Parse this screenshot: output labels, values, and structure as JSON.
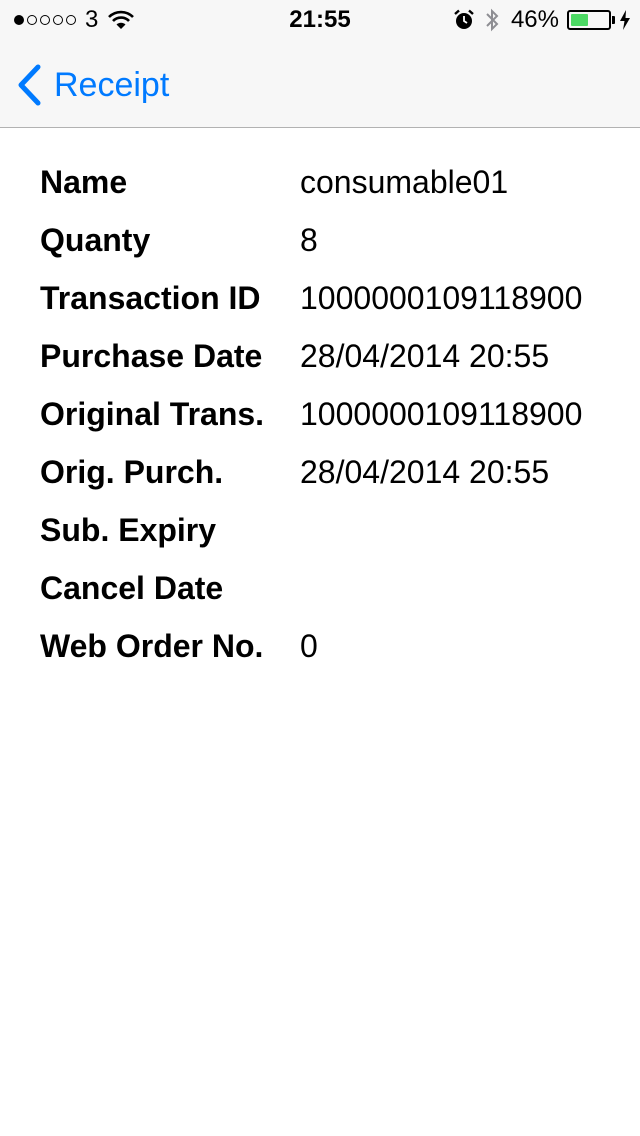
{
  "status_bar": {
    "signal_dots": [
      true,
      false,
      false,
      false,
      false
    ],
    "carrier": "3",
    "time": "21:55",
    "battery_percent_text": "46%",
    "battery_level": 0.46,
    "battery_color": "#4cd964",
    "icons": [
      "wifi-icon",
      "alarm-icon",
      "bluetooth-icon",
      "battery-icon",
      "charging-bolt-icon"
    ]
  },
  "navbar": {
    "back_label": "Receipt",
    "accent": "#007aff"
  },
  "receipt": {
    "rows": [
      {
        "label": "Name",
        "value": "consumable01"
      },
      {
        "label": "Quanty",
        "value": "8"
      },
      {
        "label": "Transaction ID",
        "value": "1000000109118900"
      },
      {
        "label": "Purchase Date",
        "value": "28/04/2014 20:55"
      },
      {
        "label": "Original Trans.",
        "value": "1000000109118900"
      },
      {
        "label": "Orig. Purch.",
        "value": "28/04/2014 20:55"
      },
      {
        "label": "Sub. Expiry",
        "value": ""
      },
      {
        "label": "Cancel Date",
        "value": ""
      },
      {
        "label": "Web Order No.",
        "value": "0"
      }
    ]
  }
}
